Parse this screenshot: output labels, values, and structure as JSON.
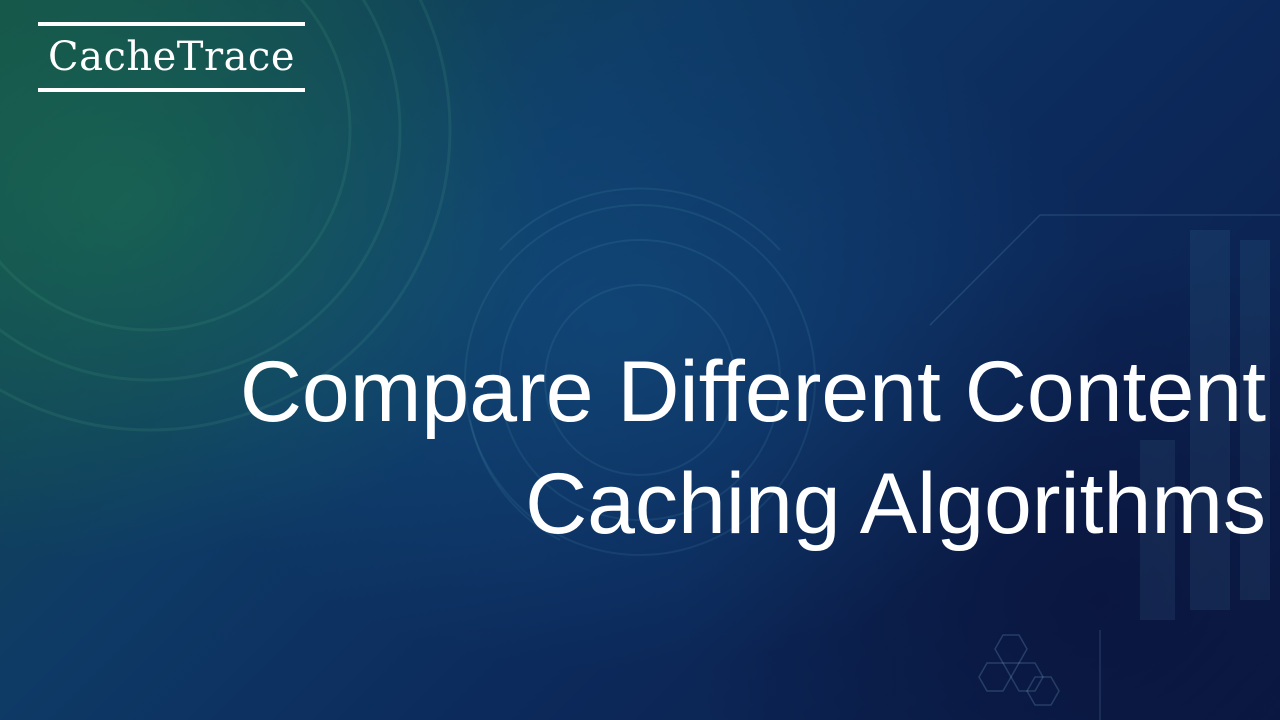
{
  "brand": {
    "name": "CacheTrace"
  },
  "slide": {
    "title_line_1": "Compare Different Content",
    "title_line_2": "Caching Algorithms"
  },
  "colors": {
    "text": "#ffffff",
    "background_dark": "#0a1a44",
    "background_teal": "#145048"
  }
}
